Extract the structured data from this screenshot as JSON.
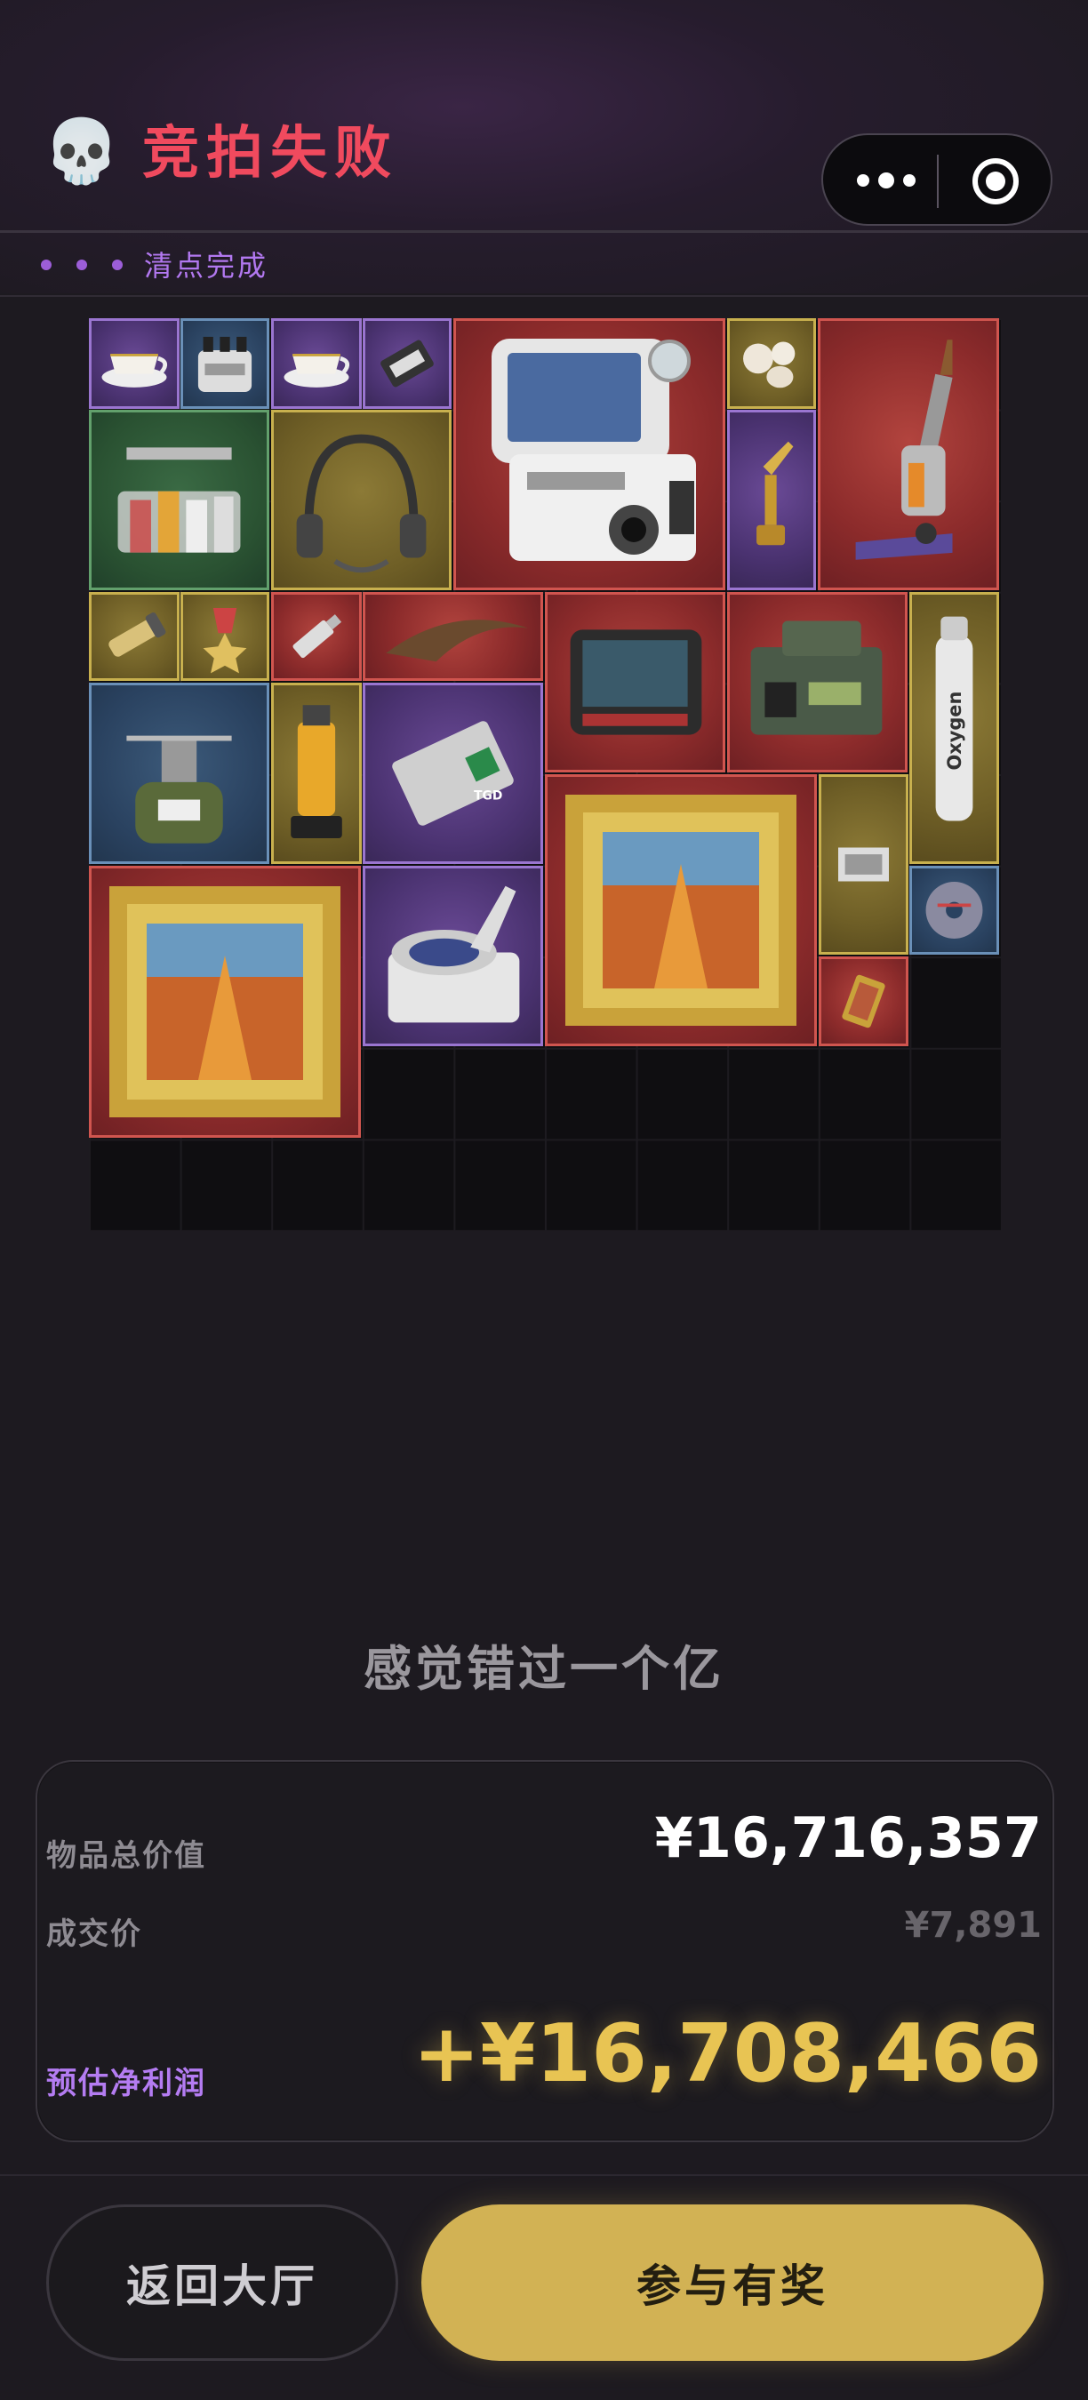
{
  "header": {
    "icon": "skull-icon",
    "title": "竞拍失败",
    "menu_icon": "more-dots-icon",
    "close_icon": "target-circle-icon"
  },
  "status": {
    "text": "清点完成"
  },
  "inventory": {
    "items": [
      {
        "name": "teacup",
        "rarity": "purple"
      },
      {
        "name": "canister-pack",
        "rarity": "blue"
      },
      {
        "name": "teacup",
        "rarity": "purple"
      },
      {
        "name": "ssd-drive",
        "rarity": "purple"
      },
      {
        "name": "medical-ventilator",
        "rarity": "red"
      },
      {
        "name": "pearls",
        "rarity": "yellow"
      },
      {
        "name": "vacuum-cleaner",
        "rarity": "red"
      },
      {
        "name": "spice-rack",
        "rarity": "green"
      },
      {
        "name": "headset",
        "rarity": "yellow"
      },
      {
        "name": "golden-statue",
        "rarity": "purple"
      },
      {
        "name": "flashlight",
        "rarity": "yellow"
      },
      {
        "name": "medal",
        "rarity": "yellow"
      },
      {
        "name": "usb-key",
        "rarity": "red"
      },
      {
        "name": "horn",
        "rarity": "red"
      },
      {
        "name": "monitor-device",
        "rarity": "red"
      },
      {
        "name": "military-radio",
        "rarity": "red"
      },
      {
        "name": "oxygen-tank",
        "rarity": "yellow"
      },
      {
        "name": "camping-stove",
        "rarity": "blue"
      },
      {
        "name": "fuel-bottle",
        "rarity": "yellow"
      },
      {
        "name": "router",
        "rarity": "purple"
      },
      {
        "name": "framed-painting",
        "rarity": "red"
      },
      {
        "name": "stamp-card",
        "rarity": "yellow"
      },
      {
        "name": "disc",
        "rarity": "blue"
      },
      {
        "name": "framed-painting-large",
        "rarity": "red"
      },
      {
        "name": "centrifuge",
        "rarity": "purple"
      },
      {
        "name": "lighter",
        "rarity": "red"
      }
    ],
    "oxygen_label": "Oxygen",
    "fuel_label": "TGD"
  },
  "quote": "感觉错过一个亿",
  "summary": {
    "total_label": "物品总价值",
    "total_value": "¥16,716,357",
    "deal_label": "成交价",
    "deal_value": "¥7,891",
    "profit_label": "预估净利润",
    "profit_value": "+¥16,708,466"
  },
  "actions": {
    "back_label": "返回大厅",
    "join_label": "参与有奖"
  },
  "colors": {
    "title": "#f04a5e",
    "status": "#b278f0",
    "profit": "#e8c453",
    "profit_label": "#b47cf2",
    "join_button": "#d2b254",
    "rarity_red": "#d0554f",
    "rarity_purple": "#9a75d0",
    "rarity_yellow": "#c8b04e",
    "rarity_blue": "#6a90b8",
    "rarity_green": "#62a06c"
  }
}
